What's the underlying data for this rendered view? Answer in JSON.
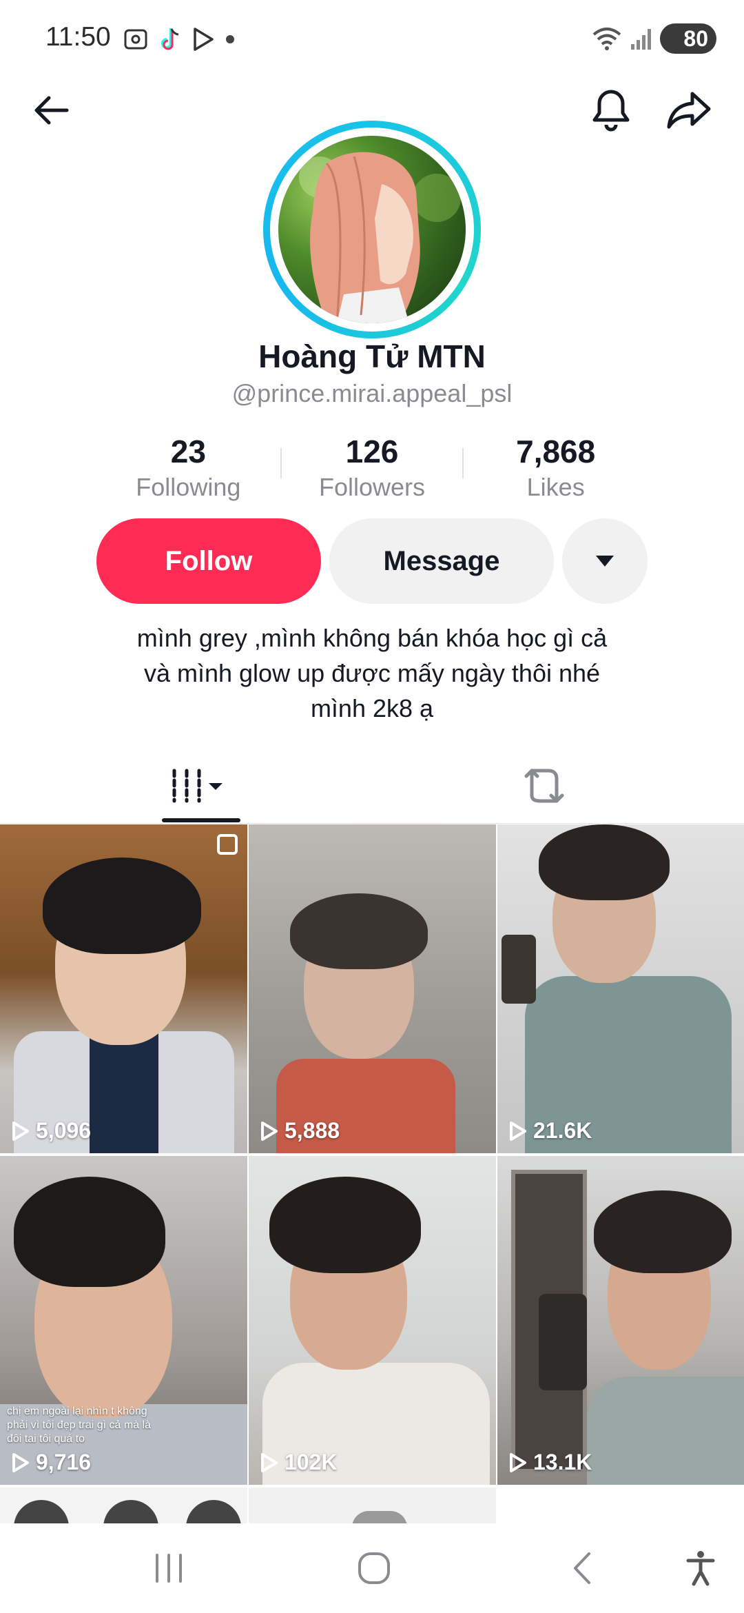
{
  "status_bar": {
    "time": "11:50",
    "battery": "80"
  },
  "profile": {
    "name": "Hoàng Tử MTN",
    "handle": "@prince.mirai.appeal_psl",
    "stats": [
      {
        "value": "23",
        "label": "Following"
      },
      {
        "value": "126",
        "label": "Followers"
      },
      {
        "value": "7,868",
        "label": "Likes"
      }
    ],
    "follow_label": "Follow",
    "message_label": "Message",
    "bio": [
      "mình grey ,mình không bán khóa học gì cả",
      "và mình glow up được mấy ngày thôi nhé",
      "mình 2k8 ạ"
    ]
  },
  "videos": [
    {
      "views": "5,096"
    },
    {
      "views": "5,888"
    },
    {
      "views": "21.6K"
    },
    {
      "views": "9,716",
      "caption": "chị em ngoài lại nhìn t không phải vì tôi đẹp trai gì cả mà là đôi tai tôi quá to"
    },
    {
      "views": "102K"
    },
    {
      "views": "13.1K"
    }
  ],
  "colors": {
    "accent": "#fe2c55",
    "ring": "#19c3e8"
  }
}
